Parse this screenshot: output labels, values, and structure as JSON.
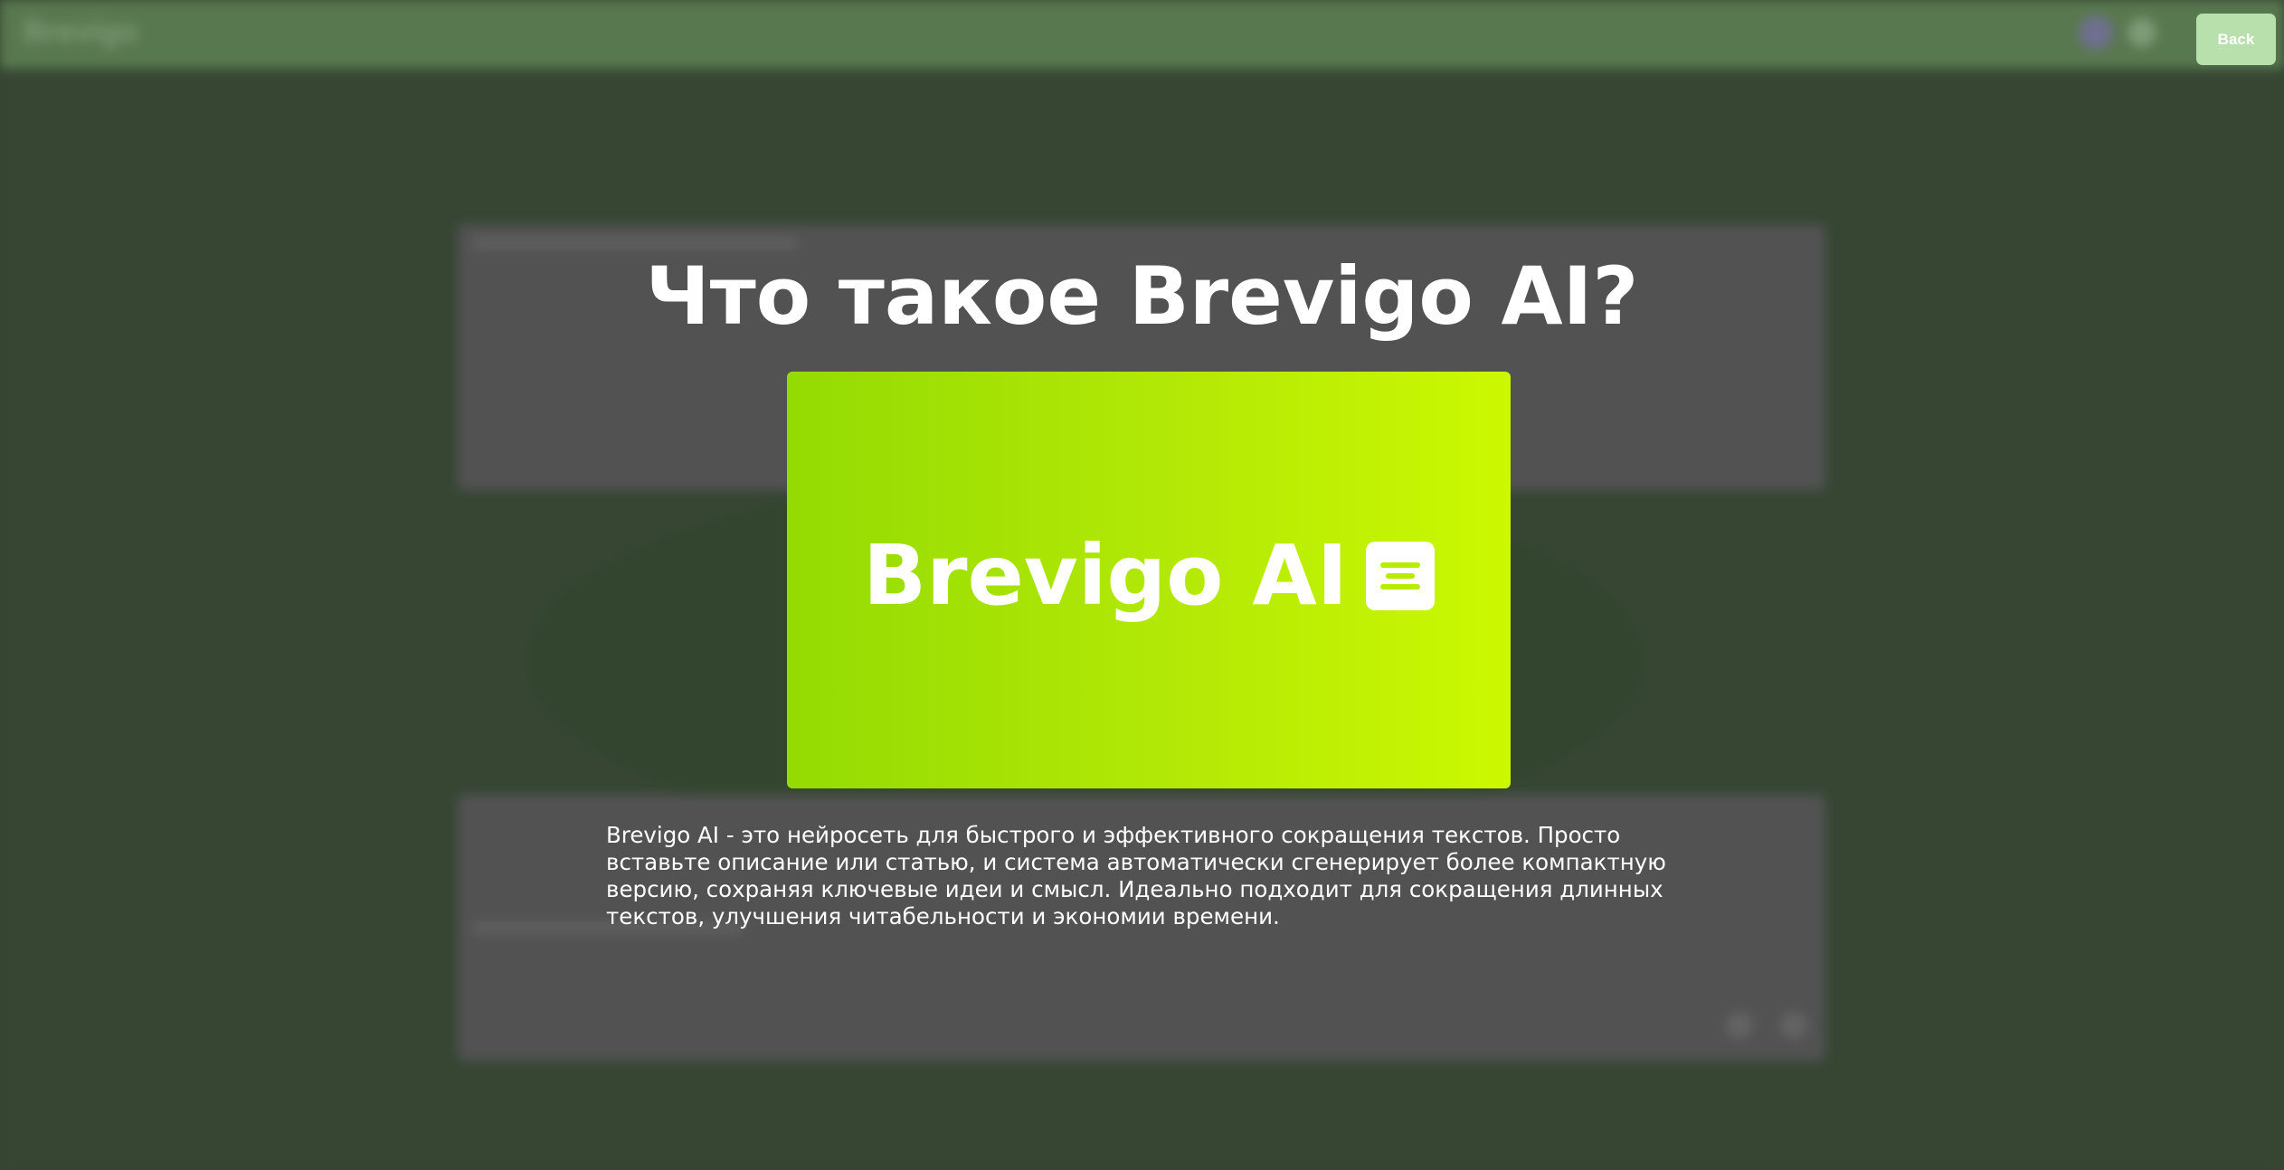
{
  "header": {
    "brand": "Brevigo",
    "back_label": "Back"
  },
  "about": {
    "title": "Что такое Brevigo AI?",
    "banner_logo_text": "Brevigo AI",
    "banner_icon": "document-lines-icon",
    "description": "Brevigo AI - это нейросеть для быстрого и эффективного сокращения текстов. Просто вставьте описание или статью, и система автоматически сгенерирует более компактную версию, сохраняя ключевые идеи и смысл. Идеально подходит для сокращения длинных текстов, улучшения читабельности и экономии времени."
  },
  "colors": {
    "overlay": "#364633",
    "header": "#58784f",
    "back_button": "#b8e0ac",
    "banner_start": "#94db03",
    "banner_end": "#ccf901",
    "text": "#ffffff"
  }
}
